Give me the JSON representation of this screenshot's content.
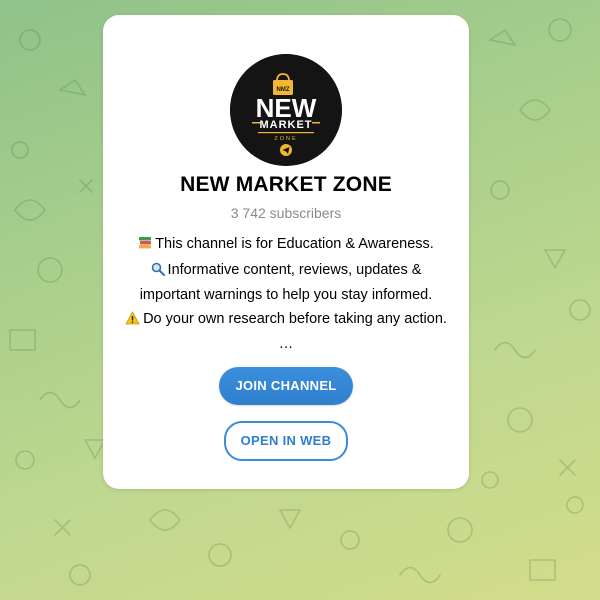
{
  "channel": {
    "title": "NEW MARKET ZONE",
    "subscribers": "3 742 subscribers",
    "logo": {
      "badge": "NMZ",
      "word1": "NEW",
      "word2": "MARKET",
      "word3": "ZONE",
      "icon": "telegram-plane-icon"
    },
    "description": [
      {
        "icon": "books-icon",
        "text": "This channel is for Education & Awareness."
      },
      {
        "icon": "magnifier-icon",
        "text": "Informative content, reviews, updates &"
      },
      {
        "icon": "",
        "text": "important warnings to help you stay informed."
      },
      {
        "icon": "warning-icon",
        "text": "Do your own research before taking any action."
      },
      {
        "icon": "",
        "text": "…"
      }
    ]
  },
  "actions": {
    "join_label": "JOIN CHANNEL",
    "web_label": "OPEN IN WEB"
  },
  "colors": {
    "accent": "#2f7fcf",
    "logo_gold": "#f2b632",
    "background_green": "#a9cf8c"
  }
}
